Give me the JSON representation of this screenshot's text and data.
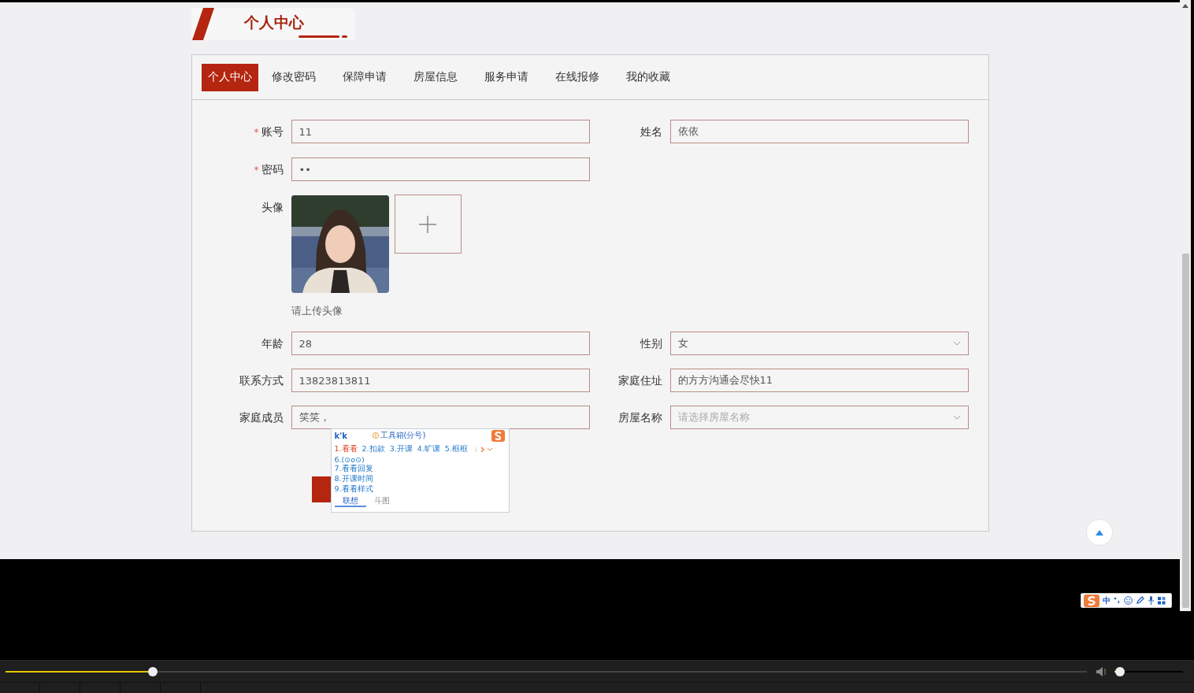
{
  "header": {
    "title": "个人中心"
  },
  "tabs": [
    {
      "label": "个人中心",
      "selected": true
    },
    {
      "label": "修改密码",
      "selected": false
    },
    {
      "label": "保障申请",
      "selected": false
    },
    {
      "label": "房屋信息",
      "selected": false
    },
    {
      "label": "服务申请",
      "selected": false
    },
    {
      "label": "在线报修",
      "selected": false
    },
    {
      "label": "我的收藏",
      "selected": false
    }
  ],
  "form": {
    "rows": [
      {
        "kind": "fields",
        "left": {
          "label": "账号",
          "required_mark": "*",
          "kind": "text",
          "value": "11"
        },
        "right": {
          "label": "姓名",
          "kind": "text",
          "value": "依依"
        }
      },
      {
        "kind": "fields",
        "left": {
          "label": "密码",
          "required_mark": "*",
          "kind": "text",
          "value": "••"
        }
      },
      {
        "kind": "avatar",
        "label": "头像",
        "hint": "请上传头像"
      },
      {
        "kind": "fields",
        "left": {
          "label": "年龄",
          "kind": "text",
          "value": "28"
        },
        "right": {
          "label": "性别",
          "kind": "select",
          "value": "女"
        }
      },
      {
        "kind": "fields",
        "left": {
          "label": "联系方式",
          "kind": "text",
          "value": "13823813811"
        },
        "right": {
          "label": "家庭住址",
          "kind": "text",
          "value": "的方方沟通会尽快11"
        }
      },
      {
        "kind": "fields",
        "left": {
          "label": "家庭成员",
          "kind": "text",
          "value": "笑笑，"
        },
        "right": {
          "label": "房屋名称",
          "kind": "select",
          "placeholder": "请选择房屋名称"
        }
      }
    ]
  },
  "ime_popup": {
    "input": "k'k",
    "toolbox": "工具箱(分号)",
    "candidates": [
      {
        "text": "1.看看",
        "selected": true
      },
      {
        "text": "2.扣款",
        "selected": false
      },
      {
        "text": "3.开课",
        "selected": false
      },
      {
        "text": "4.旷课",
        "selected": false
      },
      {
        "text": "5.框框",
        "selected": false
      },
      {
        "text": "6.(⊙ο⊙)",
        "selected": false
      },
      {
        "text": "7.看看回复",
        "selected": false
      },
      {
        "text": "8.开课时间",
        "selected": false
      },
      {
        "text": "9.看看样式",
        "selected": false
      }
    ],
    "tabs": [
      {
        "label": "联想",
        "selected": true
      },
      {
        "label": "斗图",
        "selected": false
      }
    ]
  },
  "ime_toolbar": {
    "mode": "中"
  },
  "player": {
    "progress": {
      "level": 0.136
    },
    "volume": {
      "level": 0.08
    }
  }
}
